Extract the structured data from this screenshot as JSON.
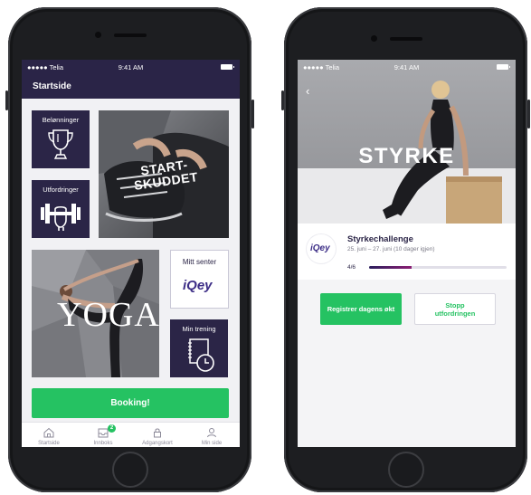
{
  "left_phone": {
    "status": {
      "carrier": "●●●●● Telia",
      "time": "9:41 AM"
    },
    "nav_title": "Startside",
    "tiles": {
      "rewards": "Belønninger",
      "challenges": "Utfordringer",
      "startskuddet": [
        "START-",
        "SKUDDET"
      ],
      "yoga": "YOGA",
      "my_center": "Mitt senter",
      "my_training": "Min trening"
    },
    "brand": "iQey",
    "booking_label": "Booking!",
    "tabs": [
      {
        "label": "Startside",
        "icon": "home-icon"
      },
      {
        "label": "Innboks",
        "icon": "inbox-icon",
        "badge": "2"
      },
      {
        "label": "Adgangskort",
        "icon": "lock-icon"
      },
      {
        "label": "Min side",
        "icon": "user-icon"
      }
    ]
  },
  "right_phone": {
    "status": {
      "carrier": "●●●●● Telia",
      "time": "9:41 AM"
    },
    "back_icon": "chevron-left-icon",
    "hero_title": "STYRKE",
    "brand": "iQey",
    "challenge": {
      "title": "Styrkechallenge",
      "dates": "25. juni – 27. juni (10 dager igjen)",
      "progress_label": "4/6",
      "progress": 0.31
    },
    "register_label": "Registrer dagens økt",
    "stop_label": [
      "Stopp",
      "utfordringen"
    ]
  },
  "colors": {
    "navy": "#2a2447",
    "accent_green": "#25c262",
    "brand_purple": "#3c2d86"
  }
}
